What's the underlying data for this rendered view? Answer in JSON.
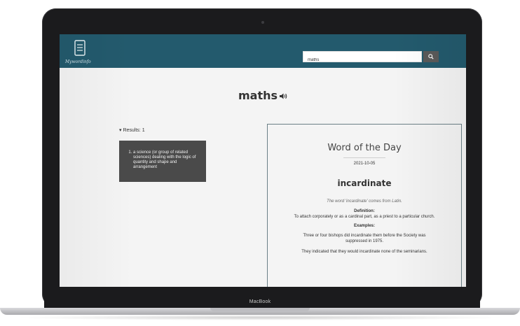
{
  "header": {
    "logo_text": "Mywordinfo",
    "search": {
      "value": "maths",
      "placeholder": ""
    }
  },
  "main": {
    "word": "maths",
    "results_label": "Results: 1",
    "definitions": [
      "a science (or group of related sciences) dealing with the logic of quantity and shape and arrangement"
    ]
  },
  "word_of_the_day": {
    "heading": "Word of the Day",
    "date": "2021-10-05",
    "word": "incardinate",
    "origin": "The word 'incardinate' comes from Latin.",
    "definition_label": "Definition:",
    "definition": "To attach corporately or as a cardinal part, as a priest to a particular church.",
    "examples_label": "Examples:",
    "examples": [
      "Three or four bishops did incardinate them before the Society was suppressed in 1975.",
      "They indicated that they would incardinate none of the seminarians."
    ]
  },
  "device": {
    "brand": "MacBook"
  },
  "colors": {
    "header": "#235a6d",
    "definition_box": "#4a4a4a",
    "search_button": "#5a5a5a"
  },
  "icons": {
    "logo": "book-icon",
    "search": "search-icon",
    "audio": "speaker-icon"
  }
}
